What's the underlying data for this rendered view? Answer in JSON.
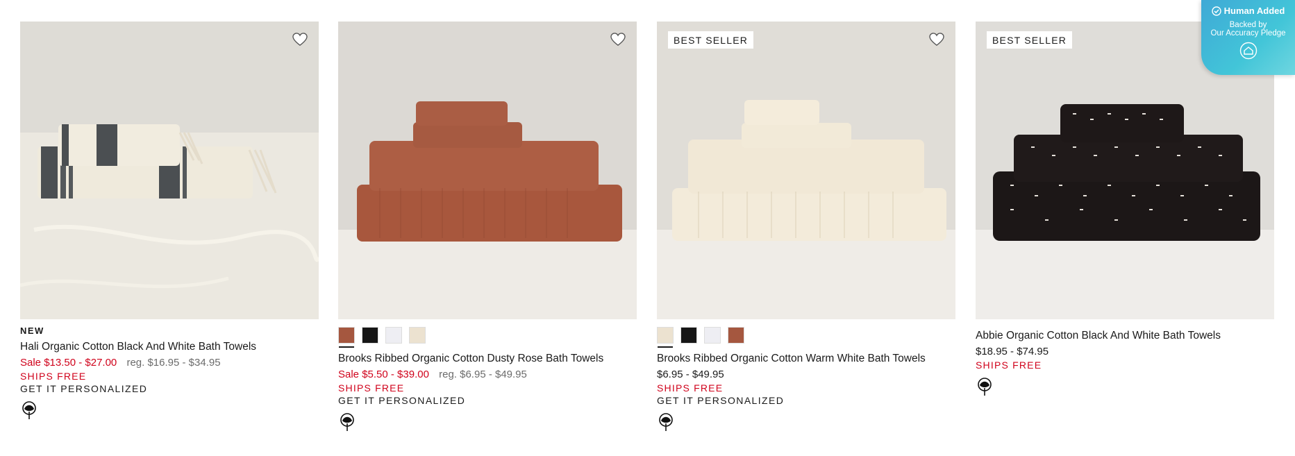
{
  "products": [
    {
      "id": "hali",
      "badge": "",
      "new_label": "NEW",
      "title": "Hali Organic Cotton Black And White Bath Towels",
      "sale_price": "Sale $13.50 - $27.00",
      "reg_price": "reg. $16.95 - $34.95",
      "ships": "SHIPS FREE",
      "personalized": "GET IT PERSONALIZED",
      "swatches": []
    },
    {
      "id": "brooks-rose",
      "badge": "",
      "title": "Brooks Ribbed Organic Cotton Dusty Rose Bath Towels",
      "sale_price": "Sale $5.50 - $39.00",
      "reg_price": "reg. $6.95 - $49.95",
      "ships": "SHIPS FREE",
      "personalized": "GET IT PERSONALIZED",
      "swatches": [
        "#a5573f",
        "#161616",
        "#eeeef3",
        "#ece2d0"
      ]
    },
    {
      "id": "brooks-white",
      "badge": "BEST SELLER",
      "title": "Brooks Ribbed Organic Cotton Warm White Bath Towels",
      "price": "$6.95 - $49.95",
      "ships": "SHIPS FREE",
      "personalized": "GET IT PERSONALIZED",
      "swatches": [
        "#ece2d0",
        "#161616",
        "#eeeef3",
        "#a5573f"
      ]
    },
    {
      "id": "abbie",
      "badge": "BEST SELLER",
      "title": "Abbie Organic Cotton Black And White Bath Towels",
      "price": "$18.95 - $74.95",
      "ships": "SHIPS FREE"
    }
  ],
  "pledge": {
    "headline": "Human Added",
    "line1": "Backed by",
    "line2": "Our Accuracy Pledge"
  },
  "icons": {
    "favorite": "heart-outline-icon",
    "organic": "cotton-flower-icon",
    "verified": "check-circle-icon",
    "house": "house-icon"
  }
}
